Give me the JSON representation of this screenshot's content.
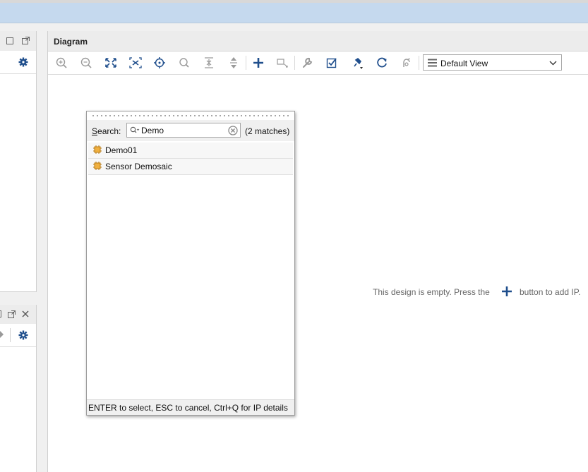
{
  "diagram": {
    "title": "Diagram",
    "view_selector": "Default View",
    "empty_message_prefix": "This design is empty. Press the",
    "empty_message_suffix": "button to add IP.",
    "toolbar": [
      "zoom-in-icon",
      "zoom-out-icon",
      "zoom-fit-icon",
      "fit-selection-icon",
      "center-icon",
      "search-icon",
      "collapse-all-icon",
      "expand-all-icon",
      "add-ip-icon",
      "add-module-icon",
      "wrench-icon",
      "validate-icon",
      "pin-icon",
      "refresh-icon",
      "regenerate-icon"
    ]
  },
  "search_popup": {
    "label": "Search:",
    "value": "Demo",
    "matches": "(2 matches)",
    "results": [
      {
        "label": "Demo01",
        "icon": "ip-core-icon"
      },
      {
        "label": "Sensor Demosaic",
        "icon": "ip-core-icon"
      }
    ],
    "footer": "ENTER to select, ESC to cancel, Ctrl+Q for IP details"
  },
  "colors": {
    "accent": "#1f5fa6",
    "title_bar": "#c5d9ee",
    "ip_icon": "#e0a030"
  }
}
